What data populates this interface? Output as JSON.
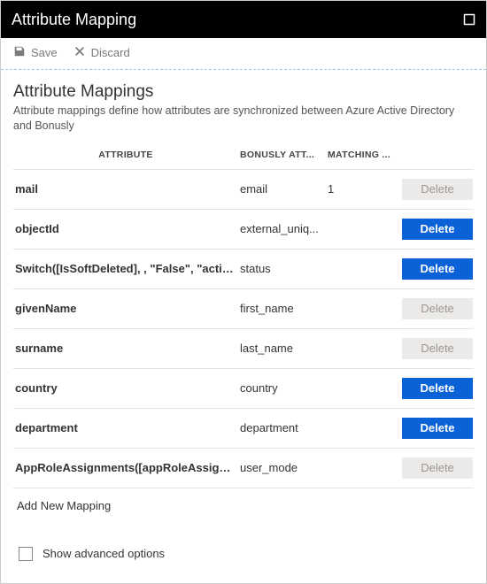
{
  "header": {
    "title": "Attribute Mapping"
  },
  "toolbar": {
    "save_label": "Save",
    "discard_label": "Discard"
  },
  "section": {
    "heading": "Attribute Mappings",
    "description": "Attribute mappings define how attributes are synchronized between Azure Active Directory and Bonusly"
  },
  "columns": {
    "attribute": "ATTRIBUTE",
    "bonusly": "BONUSLY ATT...",
    "matching": "MATCHING ..."
  },
  "rows": [
    {
      "attribute": "mail",
      "bonusly": "email",
      "matching": "1",
      "delete_enabled": false
    },
    {
      "attribute": "objectId",
      "bonusly": "external_uniq...",
      "matching": "",
      "delete_enabled": true
    },
    {
      "attribute": "Switch([IsSoftDeleted], , \"False\", \"active\", \"True",
      "bonusly": "status",
      "matching": "",
      "delete_enabled": true
    },
    {
      "attribute": "givenName",
      "bonusly": "first_name",
      "matching": "",
      "delete_enabled": false
    },
    {
      "attribute": "surname",
      "bonusly": "last_name",
      "matching": "",
      "delete_enabled": false
    },
    {
      "attribute": "country",
      "bonusly": "country",
      "matching": "",
      "delete_enabled": true
    },
    {
      "attribute": "department",
      "bonusly": "department",
      "matching": "",
      "delete_enabled": true
    },
    {
      "attribute": "AppRoleAssignments([appRoleAssignments])",
      "bonusly": "user_mode",
      "matching": "",
      "delete_enabled": false
    }
  ],
  "delete_label": "Delete",
  "add_new_label": "Add New Mapping",
  "advanced_label": "Show advanced options"
}
